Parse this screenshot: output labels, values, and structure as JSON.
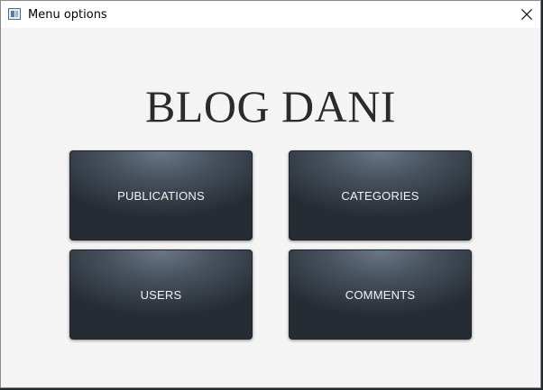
{
  "window": {
    "title": "Menu options",
    "icon": "app-window-icon",
    "close_icon": "close-icon"
  },
  "main": {
    "heading": "BLOG DANI",
    "buttons": {
      "publications": "PUBLICATIONS",
      "categories": "CATEGORIES",
      "users": "USERS",
      "comments": "COMMENTS"
    }
  },
  "colors": {
    "window_background": "#f4f4f4",
    "button_gradient_top": "#6a7786",
    "button_gradient_bottom": "#262c33",
    "button_text": "#f2f2f2",
    "heading_text": "#2b2b2b"
  }
}
